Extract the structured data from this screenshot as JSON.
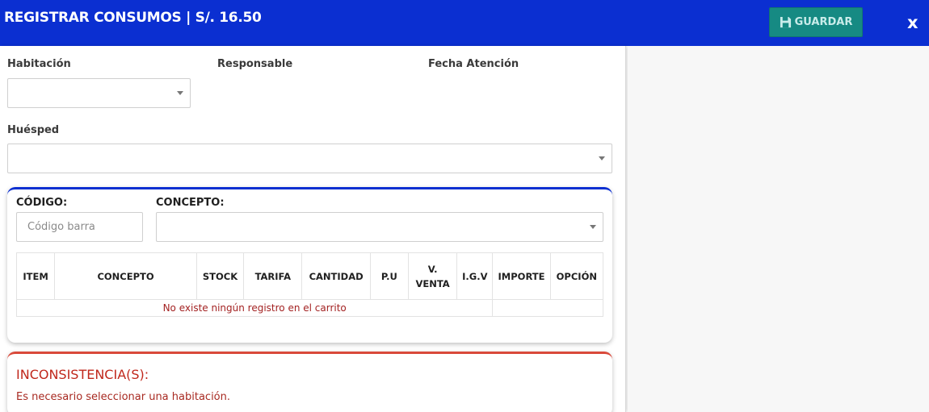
{
  "header": {
    "title": "REGISTRAR CONSUMOS | S/. 16.50",
    "save_label": "GUARDAR",
    "close_label": "x"
  },
  "form": {
    "habitacion_label": "Habitación",
    "responsable_label": "Responsable",
    "fecha_label": "Fecha Atención",
    "huesped_label": "Huésped"
  },
  "product": {
    "codigo_label": "CÓDIGO:",
    "codigo_placeholder": "Código barra",
    "concepto_label": "CONCEPTO:"
  },
  "table": {
    "columns": [
      "ITEM",
      "CONCEPTO",
      "STOCK",
      "TARIFA",
      "CANTIDAD",
      "P.U",
      "V. VENTA",
      "I.G.V",
      "IMPORTE",
      "OPCIÓN"
    ],
    "empty_message": "No existe ningún registro en el carrito"
  },
  "alert": {
    "title": "INCONSISTENCIA(S):",
    "message": "Es necesario seleccionar una habitación."
  },
  "colors": {
    "header": "#0b2fd1",
    "save_button": "#168a83",
    "alert": "#c0281c"
  }
}
